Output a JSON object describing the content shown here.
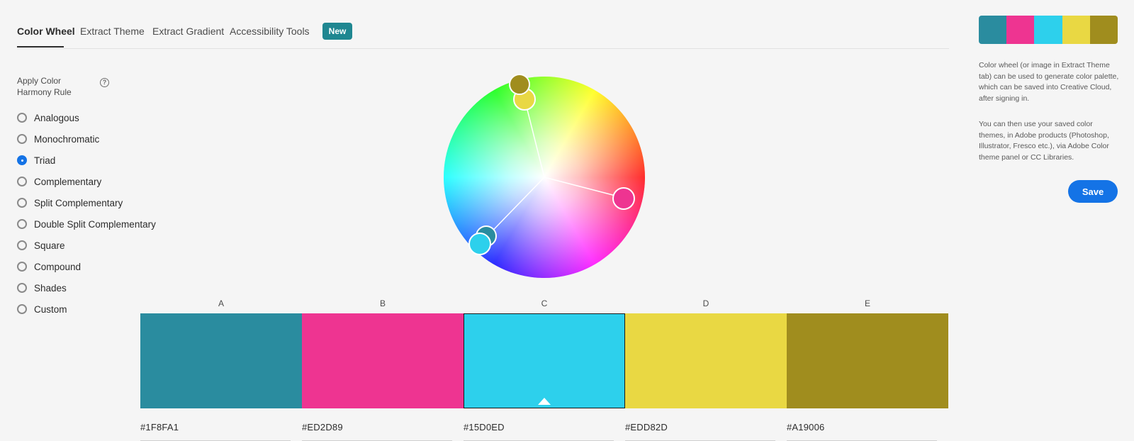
{
  "tabs": [
    {
      "label": "Color Wheel",
      "active": true
    },
    {
      "label": "Extract Theme",
      "active": false
    },
    {
      "label": "Extract Gradient",
      "active": false
    },
    {
      "label": "Accessibility Tools",
      "active": false
    }
  ],
  "new_badge": "New",
  "harmony": {
    "title": "Apply Color Harmony Rule",
    "help_icon": "?",
    "rules": [
      {
        "label": "Analogous",
        "checked": false
      },
      {
        "label": "Monochromatic",
        "checked": false
      },
      {
        "label": "Triad",
        "checked": true
      },
      {
        "label": "Complementary",
        "checked": false
      },
      {
        "label": "Split Complementary",
        "checked": false
      },
      {
        "label": "Double Split Complementary",
        "checked": false
      },
      {
        "label": "Square",
        "checked": false
      },
      {
        "label": "Compound",
        "checked": false
      },
      {
        "label": "Shades",
        "checked": false
      },
      {
        "label": "Custom",
        "checked": false
      }
    ]
  },
  "palette": [
    {
      "letter": "A",
      "hex": "#1F8FA1",
      "color": "#2a8c9f"
    },
    {
      "letter": "B",
      "hex": "#ED2D89",
      "color": "#ee3491"
    },
    {
      "letter": "C",
      "hex": "#15D0ED",
      "color": "#2dd0ec",
      "selected": true
    },
    {
      "letter": "D",
      "hex": "#EDD82D",
      "color": "#e9d843"
    },
    {
      "letter": "E",
      "hex": "#A19006",
      "color": "#a08d1e"
    }
  ],
  "sidebar": {
    "info_1": "Color wheel (or image in Extract Theme tab) can be used to generate color palette, which can be saved into Creative Cloud, after signing in.",
    "info_2": "You can then use your saved color themes, in Adobe products (Photoshop, Illustrator, Fresco etc.), via Adobe Color theme panel or CC Libraries.",
    "save_label": "Save"
  },
  "colors": {
    "accent": "#1473e6",
    "badge": "#1f8791"
  }
}
